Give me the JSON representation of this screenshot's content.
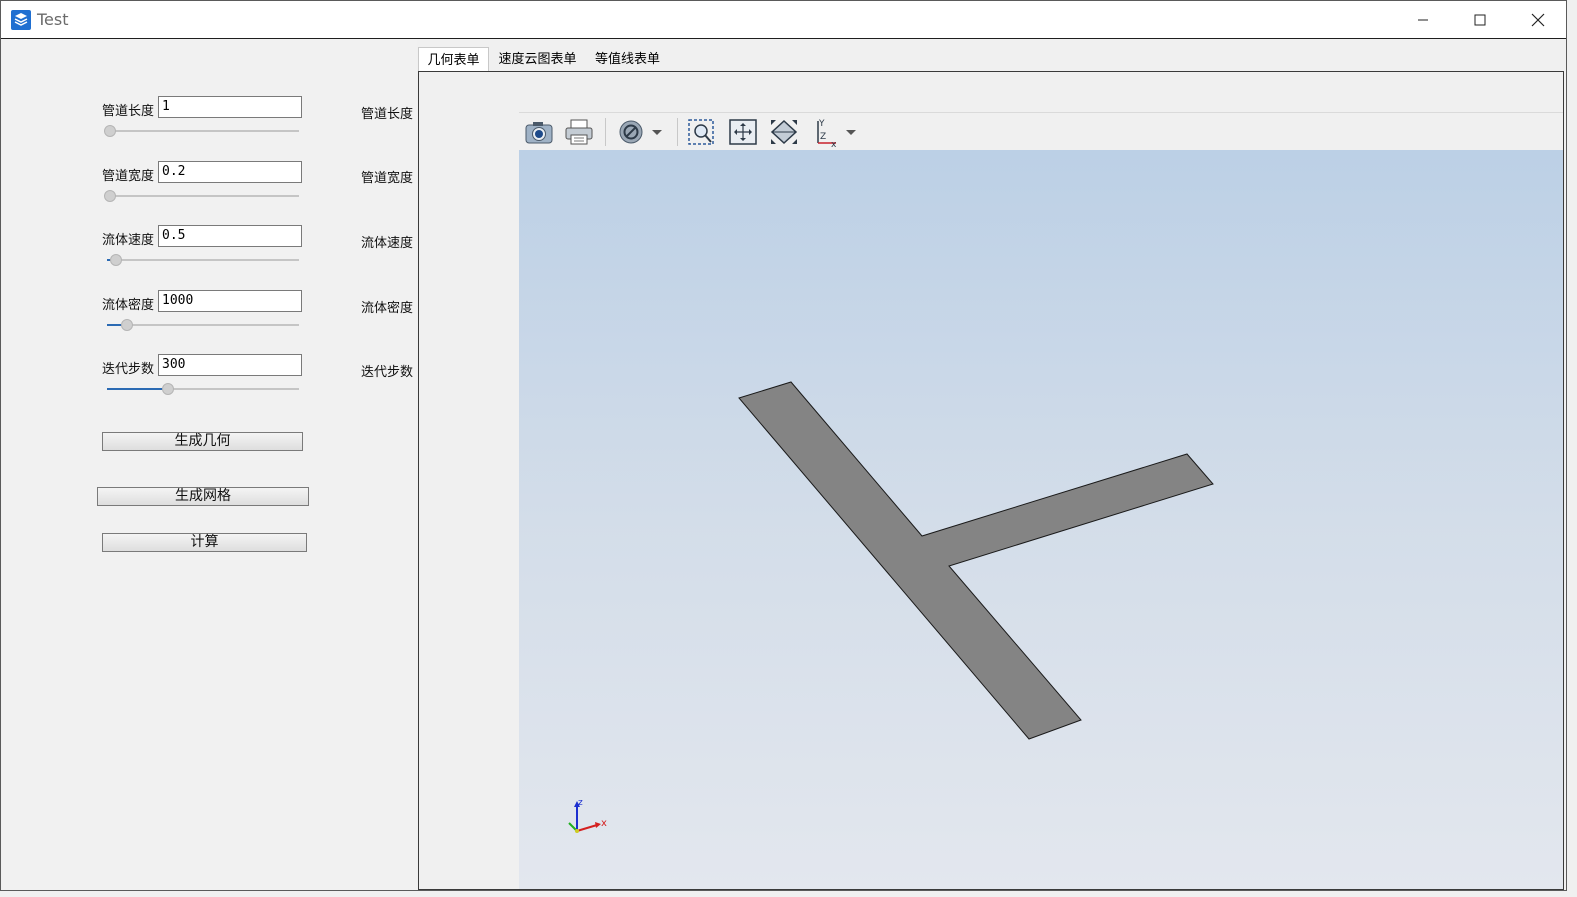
{
  "window": {
    "title": "Test"
  },
  "left_panel": {
    "fields": [
      {
        "label": "管道长度",
        "value": "1",
        "slider_fraction": 0.0
      },
      {
        "label": "管道宽度",
        "value": "0.2",
        "slider_fraction": 0.0
      },
      {
        "label": "流体速度",
        "value": "0.5",
        "slider_fraction": 0.03
      },
      {
        "label": "流体密度",
        "value": "1000",
        "slider_fraction": 0.09
      },
      {
        "label": "迭代步数",
        "value": "300",
        "slider_fraction": 0.3
      }
    ],
    "buttons": {
      "generate_geometry": "生成几何",
      "generate_mesh": "生成网格",
      "compute": "计算"
    }
  },
  "tabs": [
    {
      "label": "几何表单",
      "active": true
    },
    {
      "label": "速度云图表单",
      "active": false
    },
    {
      "label": "等值线表单",
      "active": false
    }
  ],
  "form_labels": [
    "管道长度",
    "管道宽度",
    "流体速度",
    "流体密度",
    "迭代步数"
  ],
  "toolbar": {
    "icons": [
      "camera-icon",
      "print-icon",
      "visibility-icon",
      "zoom-box-icon",
      "fit-all-icon",
      "reset-view-icon",
      "view-axis-icon"
    ]
  },
  "viewport": {
    "axis_labels": {
      "x": "x",
      "y": "Y",
      "z": "z"
    },
    "shape_color": "#848484",
    "background_top": "#bcd0e6",
    "background_bottom": "#e3e7ee"
  }
}
